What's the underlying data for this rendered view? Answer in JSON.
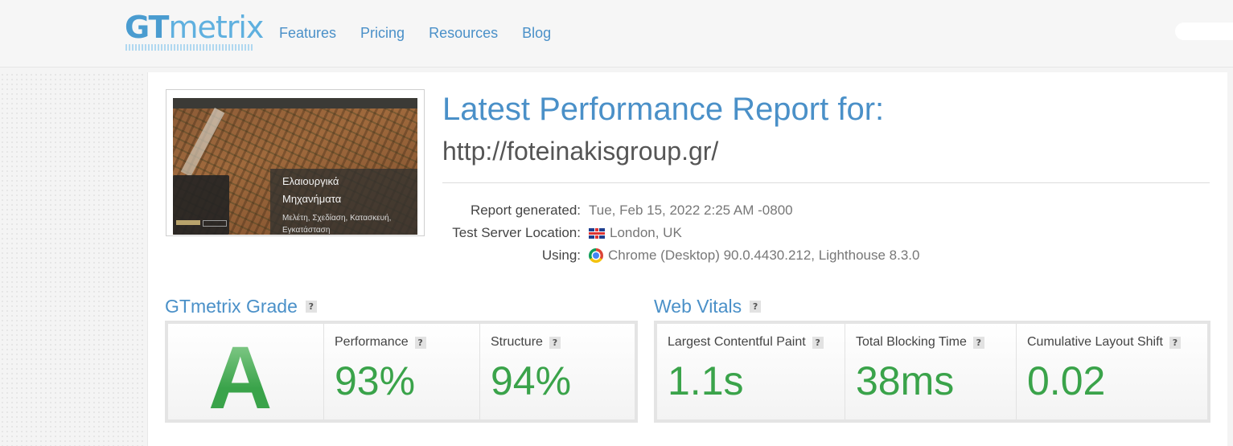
{
  "header": {
    "logo_gt": "GT",
    "logo_metrix": "metrix",
    "nav": [
      "Features",
      "Pricing",
      "Resources",
      "Blog"
    ]
  },
  "screenshot": {
    "title_line1": "Ελαιουργικά",
    "title_line2": "Μηχανήματα",
    "subtitle": "Μελέτη, Σχεδίαση, Κατασκευή, Εγκατάσταση"
  },
  "report": {
    "title": "Latest Performance Report for:",
    "url": "http://foteinakisgroup.gr/",
    "meta": [
      {
        "label": "Report generated:",
        "value": "Tue, Feb 15, 2022 2:25 AM -0800",
        "icon": ""
      },
      {
        "label": "Test Server Location:",
        "value": "London, UK",
        "icon": "uk-flag-icon"
      },
      {
        "label": "Using:",
        "value": "Chrome (Desktop) 90.0.4430.212, Lighthouse 8.3.0",
        "icon": "chrome-icon"
      }
    ]
  },
  "grade": {
    "section_title": "GTmetrix Grade",
    "letter": "A",
    "performance_label": "Performance",
    "performance_value": "93%",
    "structure_label": "Structure",
    "structure_value": "94%"
  },
  "vitals": {
    "section_title": "Web Vitals",
    "lcp_label": "Largest Contentful Paint",
    "lcp_value": "1.1s",
    "tbt_label": "Total Blocking Time",
    "tbt_value": "38ms",
    "cls_label": "Cumulative Layout Shift",
    "cls_value": "0.02"
  },
  "help_mark": "?",
  "colors": {
    "brand_blue": "#4a90c8",
    "grade_green": "#3aa34a"
  }
}
